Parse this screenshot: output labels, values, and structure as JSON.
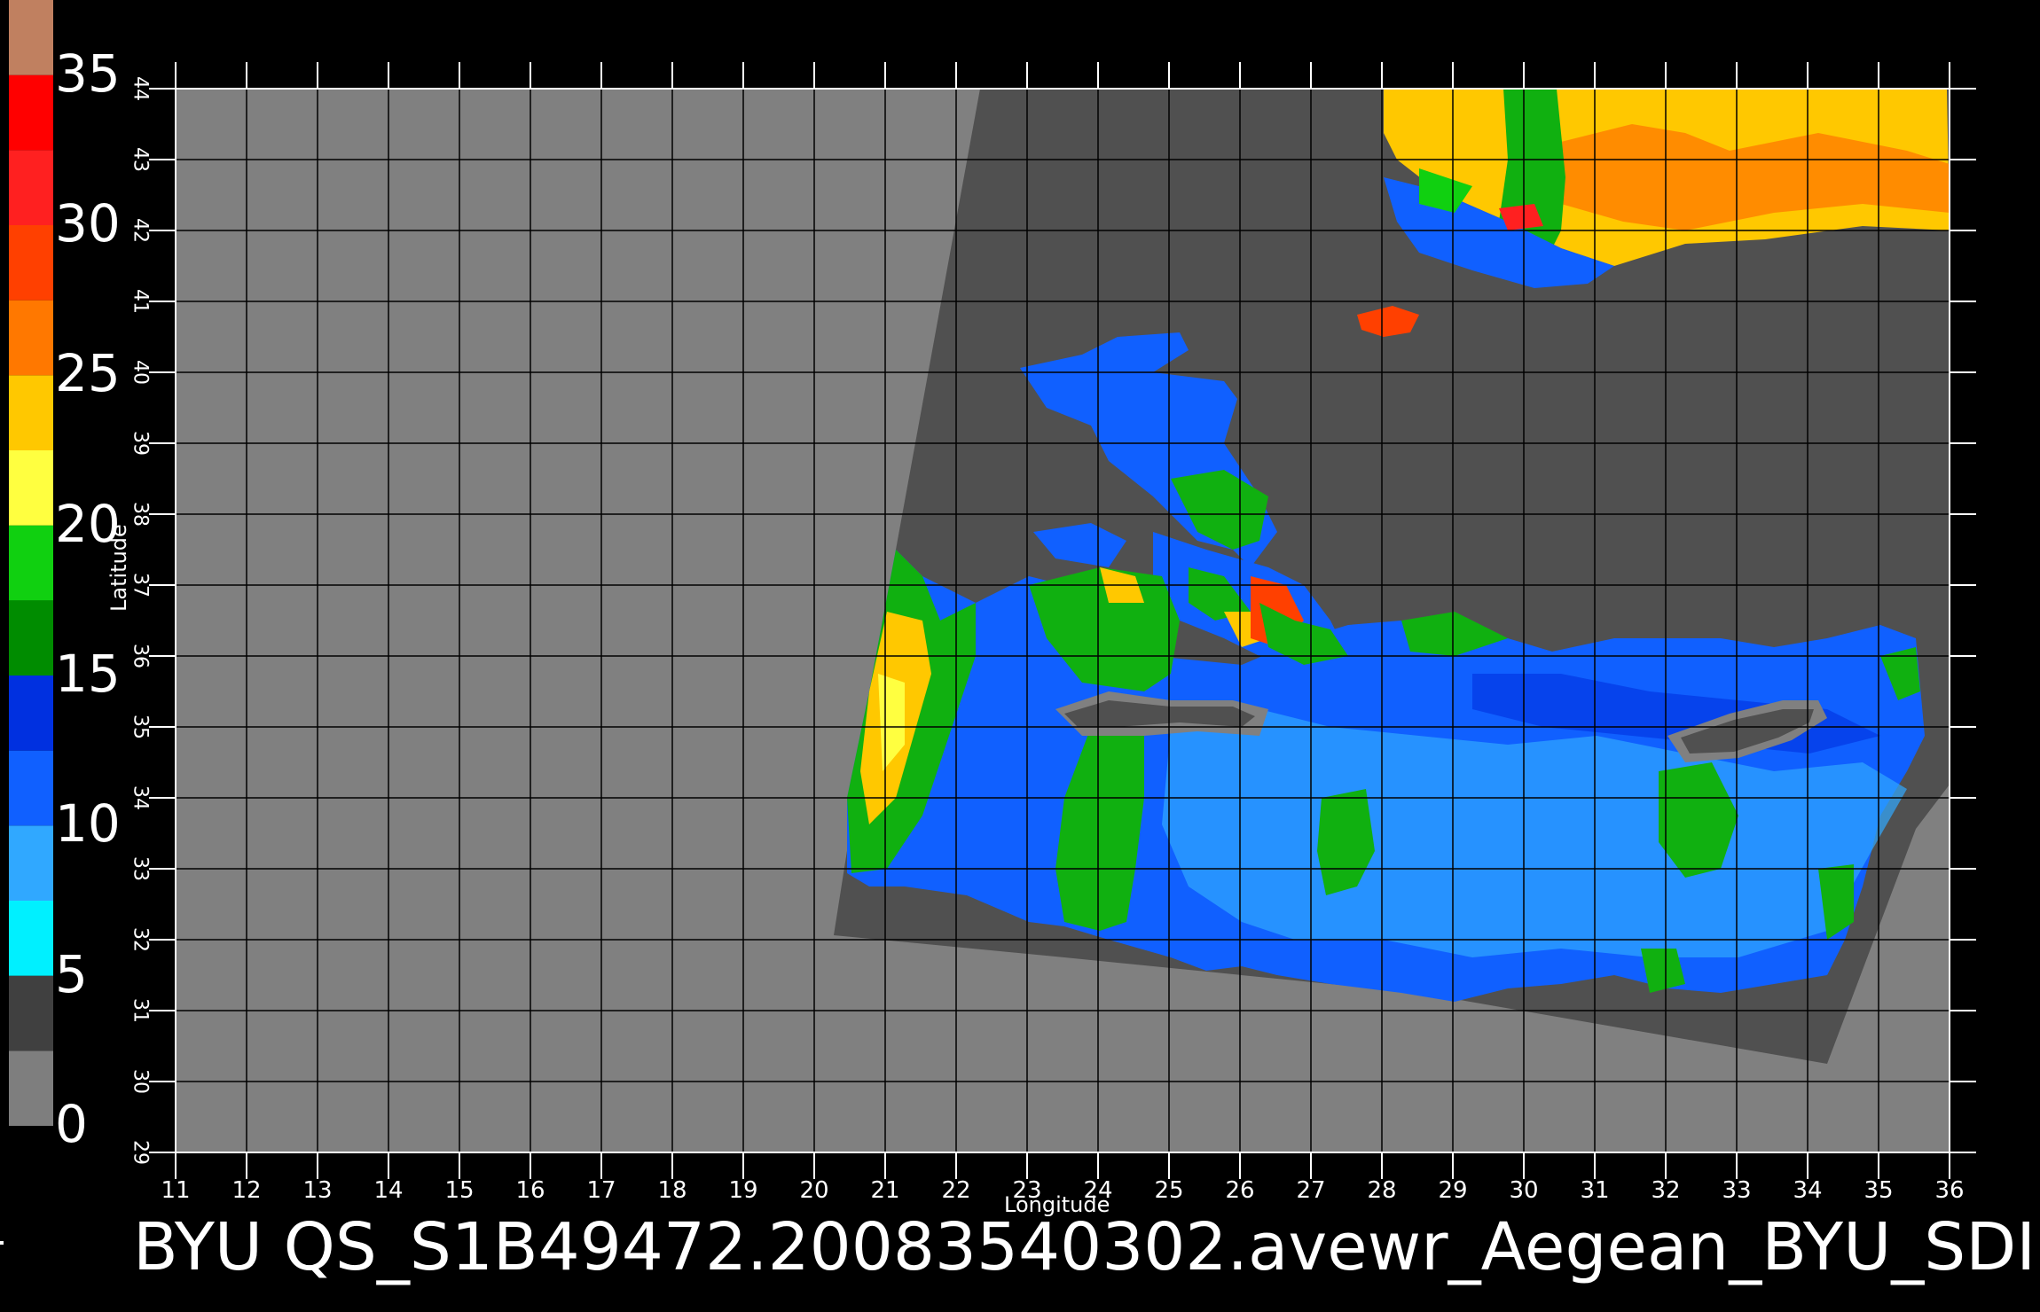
{
  "title": "BYU  QS_S1B49472.20083540302.avewr_Aegean_BYU_SDI",
  "x_axis": {
    "label": "Longitude",
    "min": 11,
    "max": 36,
    "ticks": [
      "11",
      "12",
      "13",
      "14",
      "15",
      "16",
      "17",
      "18",
      "19",
      "20",
      "21",
      "22",
      "23",
      "24",
      "25",
      "26",
      "27",
      "28",
      "29",
      "30",
      "31",
      "32",
      "33",
      "34",
      "35",
      "36"
    ]
  },
  "y_axis": {
    "label": "Latitude",
    "min": 29,
    "max": 44,
    "ticks": [
      "29",
      "30",
      "31",
      "32",
      "33",
      "34",
      "35",
      "36",
      "37",
      "38",
      "39",
      "40",
      "41",
      "42",
      "43",
      "44"
    ]
  },
  "colorbar": {
    "labels": [
      "35",
      "30",
      "25",
      "20",
      "15",
      "10",
      "5",
      "0"
    ],
    "segments": [
      {
        "from": 0,
        "to": 2.5,
        "color": "#7e7e7e"
      },
      {
        "from": 2.5,
        "to": 5,
        "color": "#404040"
      },
      {
        "from": 5,
        "to": 7.5,
        "color": "#00f0ff"
      },
      {
        "from": 7.5,
        "to": 10,
        "color": "#30a8ff"
      },
      {
        "from": 10,
        "to": 12.5,
        "color": "#1060ff"
      },
      {
        "from": 12.5,
        "to": 15,
        "color": "#0030e0"
      },
      {
        "from": 15,
        "to": 17.5,
        "color": "#008c00"
      },
      {
        "from": 17.5,
        "to": 20,
        "color": "#10d010"
      },
      {
        "from": 20,
        "to": 22.5,
        "color": "#ffff40"
      },
      {
        "from": 22.5,
        "to": 25,
        "color": "#ffc800"
      },
      {
        "from": 25,
        "to": 27.5,
        "color": "#ff7800"
      },
      {
        "from": 27.5,
        "to": 30,
        "color": "#ff4000"
      },
      {
        "from": 30,
        "to": 32.5,
        "color": "#ff2020"
      },
      {
        "from": 32.5,
        "to": 35,
        "color": "#ff0000"
      },
      {
        "from": 35,
        "to": 37.5,
        "color": "#c08060"
      }
    ]
  },
  "colors": {
    "background": "#000000",
    "offswath": "#808080",
    "land": "#505050",
    "grid": "#000000",
    "text": "#ffffff"
  }
}
